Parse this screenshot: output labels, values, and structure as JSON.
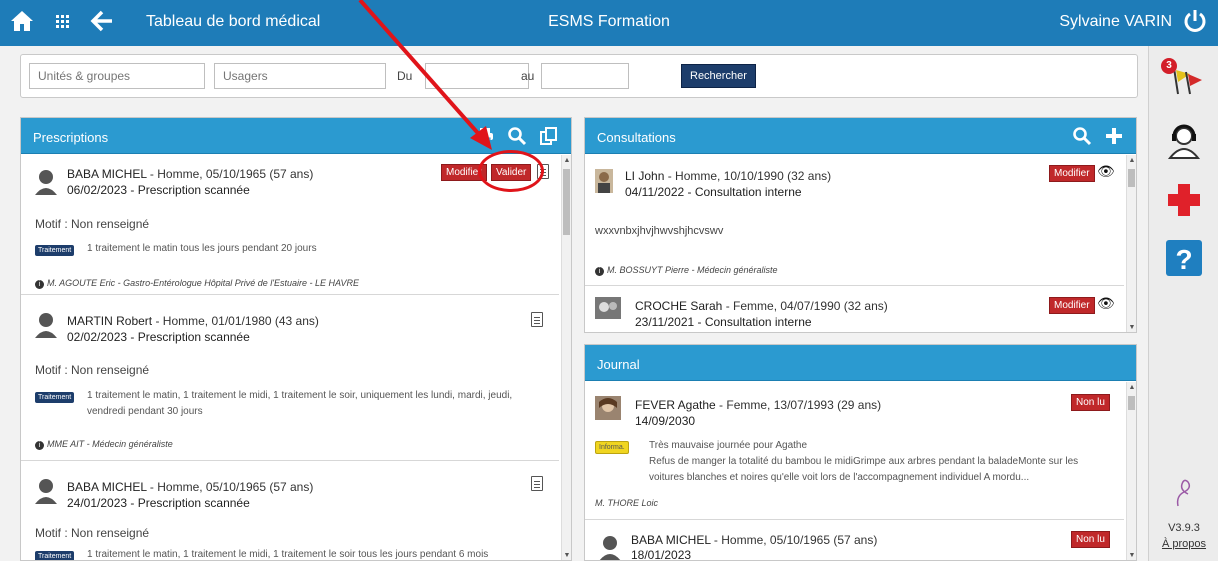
{
  "topbar": {
    "title": "Tableau de bord médical",
    "center_title": "ESMS Formation",
    "user": "Sylvaine VARIN",
    "icons": [
      "home-icon",
      "grid-icon",
      "back-arrow-icon",
      "power-icon"
    ]
  },
  "search": {
    "units_placeholder": "Unités & groupes",
    "users_placeholder": "Usagers",
    "du_label": "Du",
    "au_label": "au",
    "button": "Rechercher"
  },
  "prescriptions": {
    "title": "Prescriptions",
    "entries": [
      {
        "name": "BABA MICHEL",
        "info": " - Homme, 05/10/1965 (57 ans)",
        "date": "06/02/2023 - Prescription scannée",
        "motif": "Motif : Non renseigné",
        "tag": "Traitement",
        "text": "1 traitement le matin tous les jours pendant 20 jours",
        "doctor": "M. AGOUTE Eric - Gastro-Entérologue Hôpital Privé de l'Estuaire - LE HAVRE",
        "btn_modify": "Modifier",
        "btn_validate": "Valider"
      },
      {
        "name": "MARTIN Robert",
        "info": " - Homme, 01/01/1980 (43 ans)",
        "date": "02/02/2023 - Prescription scannée",
        "motif": "Motif : Non renseigné",
        "tag": "Traitement",
        "text": "1 traitement le matin, 1 traitement le midi, 1 traitement le soir, uniquement les lundi, mardi, jeudi, vendredi pendant 30 jours",
        "doctor": "MME AIT - Médecin généraliste"
      },
      {
        "name": "BABA MICHEL",
        "info": " - Homme, 05/10/1965 (57 ans)",
        "date": "24/01/2023 - Prescription scannée",
        "motif": "Motif : Non renseigné",
        "tag": "Traitement",
        "text": "1 traitement le matin, 1 traitement le midi, 1 traitement le soir tous les jours pendant 6 mois"
      }
    ]
  },
  "consultations": {
    "title": "Consultations",
    "entries": [
      {
        "name": "LI John",
        "info": " - Homme, 10/10/1990 (32 ans)",
        "date": "04/11/2022 - Consultation interne",
        "text": "wxxvnbxjhvjhwvshjhcvswv",
        "doctor": "M. BOSSUYT Pierre - Médecin généraliste",
        "btn_modify": "Modifier"
      },
      {
        "name": "CROCHE Sarah",
        "info": " - Femme, 04/07/1990 (32 ans)",
        "date": "23/11/2021 - Consultation interne",
        "btn_modify": "Modifier"
      }
    ]
  },
  "journal": {
    "title": "Journal",
    "entries": [
      {
        "name": "FEVER Agathe",
        "info": " - Femme, 13/07/1993 (29 ans)",
        "date": "14/09/2030",
        "tag": "Informa.",
        "line1": "Très mauvaise journée pour Agathe",
        "line2": "Refus de manger la totalité du bambou le midiGrimpe aux arbres pendant la baladeMonte sur les",
        "line3": "voitures blanches et noires qu'elle voit lors de l'accompagnement individuel A mordu...",
        "author": "M. THORE Loic",
        "status": "Non lu"
      },
      {
        "name": "BABA MICHEL",
        "info": " - Homme, 05/10/1965 (57 ans)",
        "date": "18/01/2023",
        "status": "Non lu"
      }
    ]
  },
  "sidebar": {
    "notif_count": "3",
    "version": "V3.9.3",
    "about": "À propos"
  },
  "colors": {
    "topbar": "#1e7cb8",
    "panel_header": "#2b9ad0",
    "red_button": "#c0282a",
    "annotation": "#e0141a"
  }
}
